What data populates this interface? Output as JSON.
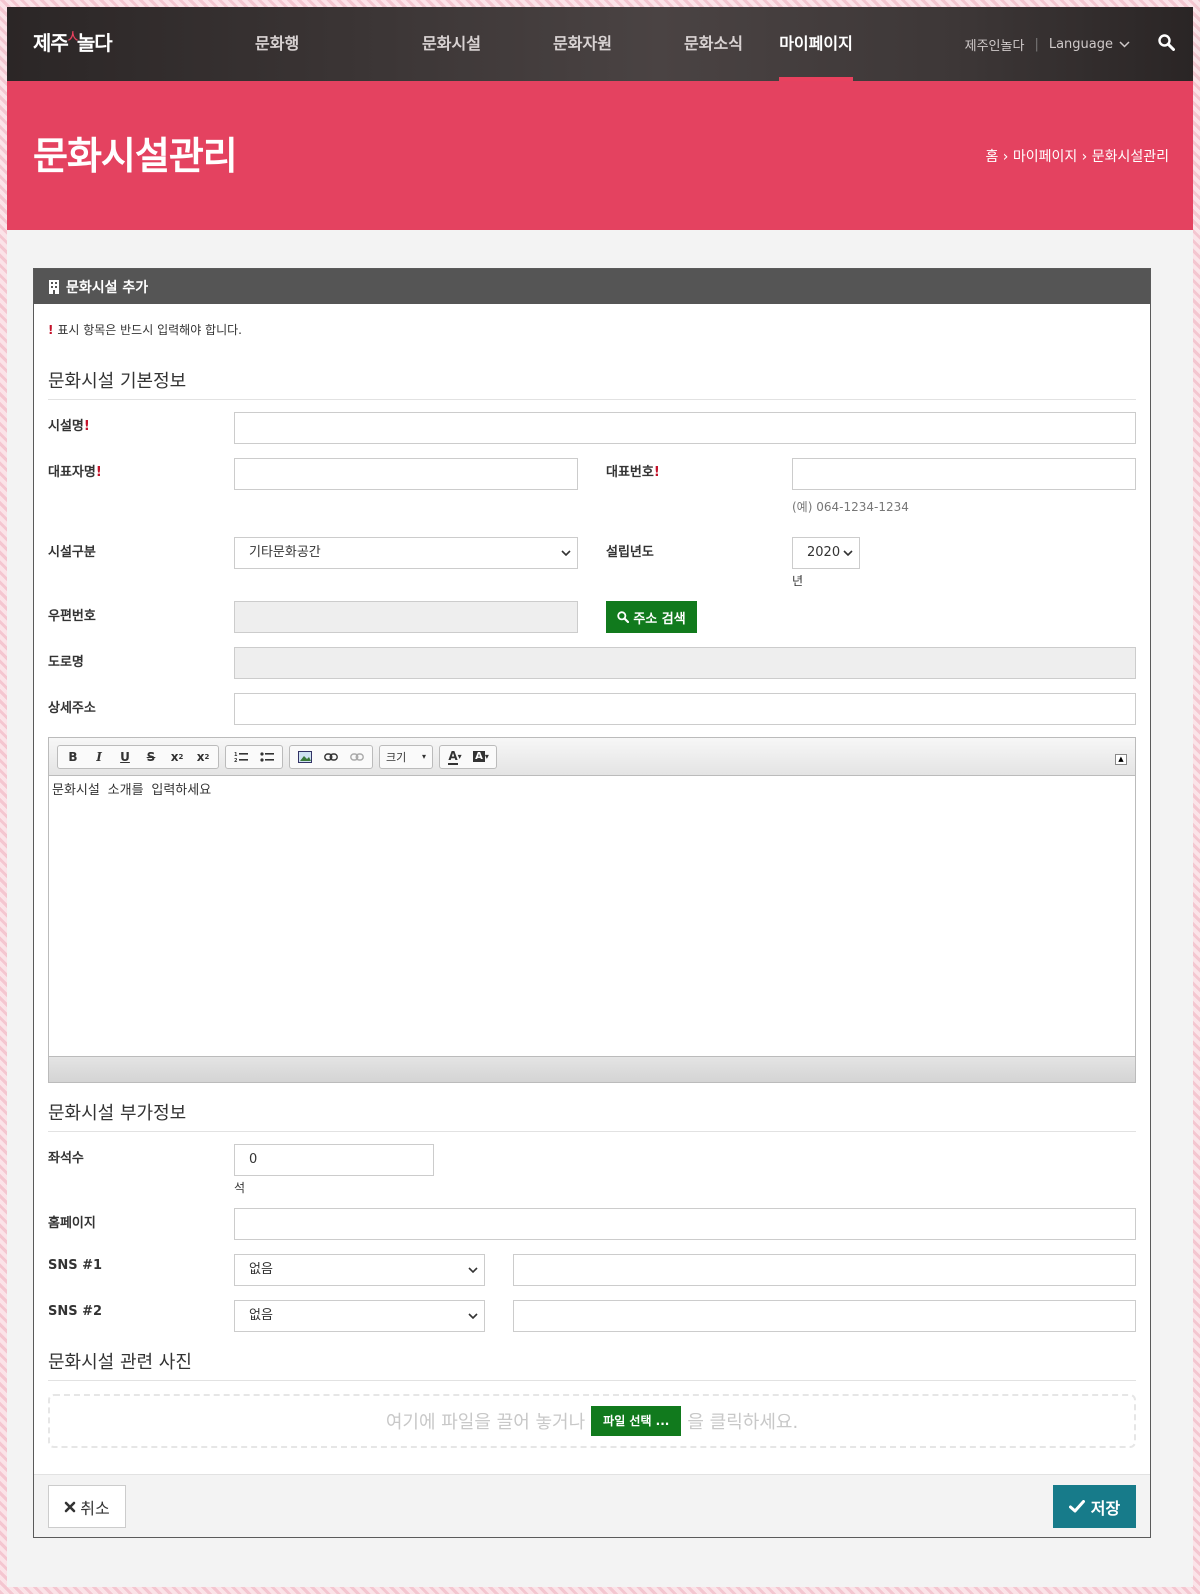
{
  "header": {
    "logo_text": "제주",
    "logo_accent": "人",
    "logo_text2": "놀다",
    "menu": [
      "문화행사",
      "문화시설",
      "문화자원",
      "문화소식",
      "마이페이지"
    ],
    "util_link": "제주인놀다",
    "language_label": "Language"
  },
  "banner": {
    "title": "문화시설관리",
    "breadcrumb": "홈 › 마이페이지 › 문화시설관리"
  },
  "card": {
    "title": "문화시설 추가",
    "required_mark": "!",
    "required_note": "표시 항목은 반드시 입력해야 합니다."
  },
  "basic": {
    "section_title": "문화시설 기본정보",
    "name_label": "시설명",
    "rep_label": "대표자명",
    "phone_label": "대표번호",
    "phone_hint": "(예) 064-1234-1234",
    "type_label": "시설구분",
    "type_value": "기타문화공간",
    "year_label": "설립년도",
    "year_value": "2020",
    "year_unit": "년",
    "zip_label": "우편번호",
    "address_search": "주소 검색",
    "road_label": "도로명",
    "detail_label": "상세주소",
    "editor_placeholder": "문화시설 소개를 입력하세요",
    "toolbar_size": "크기"
  },
  "extra": {
    "section_title": "문화시설 부가정보",
    "seats_label": "좌석수",
    "seats_value": "0",
    "seats_unit": "석",
    "homepage_label": "홈페이지",
    "sns1_label": "SNS #1",
    "sns1_value": "없음",
    "sns2_label": "SNS #2",
    "sns2_value": "없음"
  },
  "photos": {
    "section_title": "문화시설 관련 사진",
    "drop_text_before": "여기에 파일을 끌어 놓거나",
    "file_button": "파일 선택 ...",
    "drop_text_after": "을 클릭하세요."
  },
  "footer": {
    "cancel_label": "취소",
    "save_label": "저장"
  },
  "colors": {
    "brand_red": "#e44260",
    "nav_dark": "#3b3535",
    "green_button": "#117a1d",
    "save_teal": "#177b8a",
    "required_red": "#c4122a"
  }
}
